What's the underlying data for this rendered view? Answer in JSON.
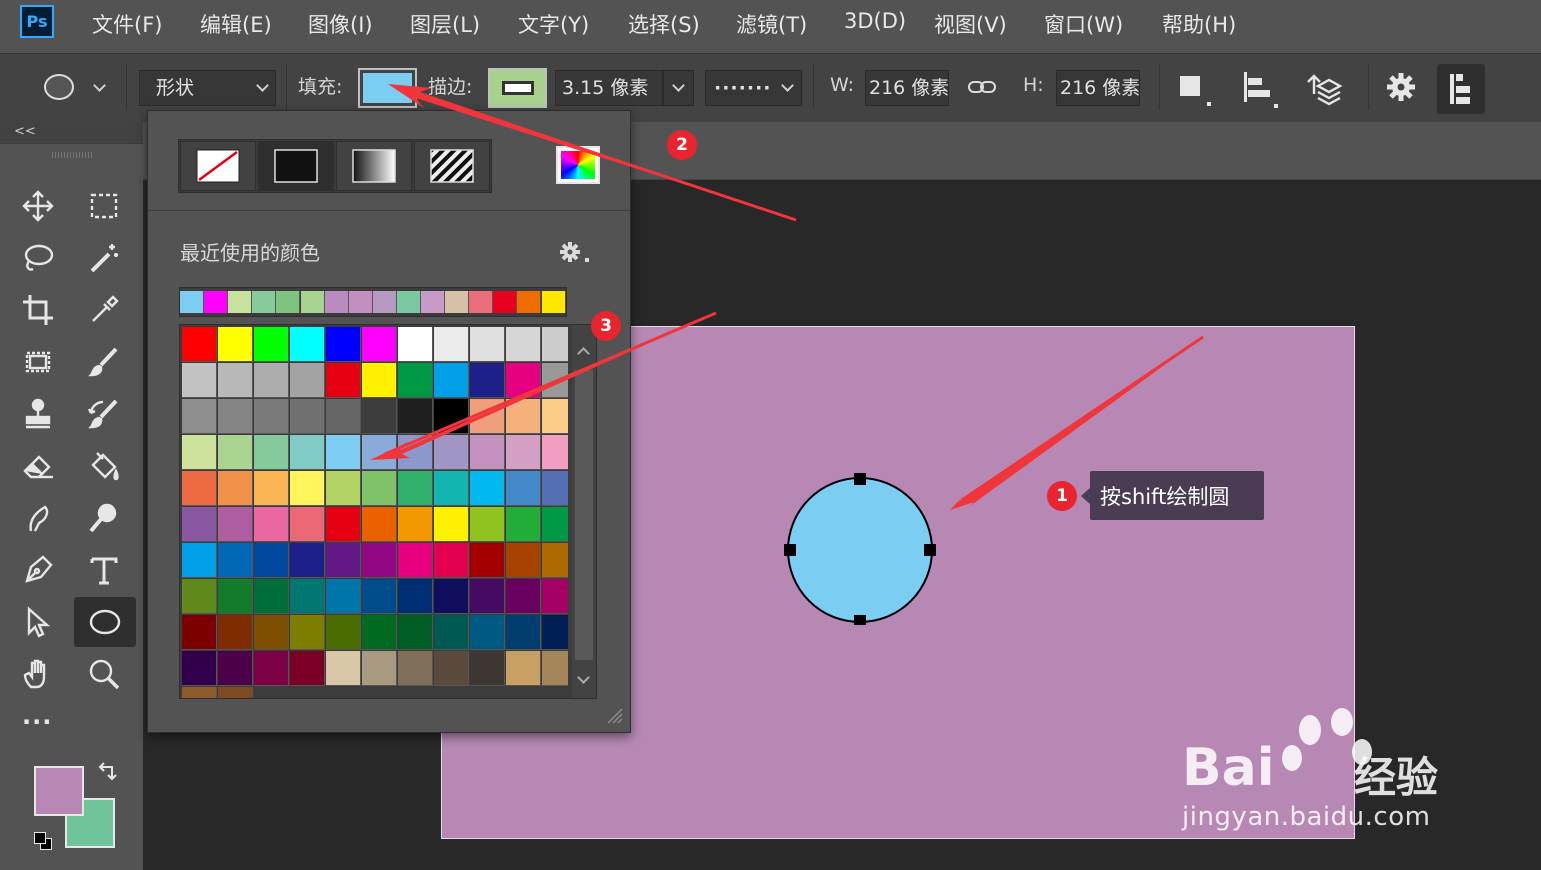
{
  "app": {
    "logo": "Ps"
  },
  "menu": [
    "文件(F)",
    "编辑(E)",
    "图像(I)",
    "图层(L)",
    "文字(Y)",
    "选择(S)",
    "滤镜(T)",
    "3D(D)",
    "视图(V)",
    "窗口(W)",
    "帮助(H)"
  ],
  "options": {
    "mode_value": "形状",
    "fill_label": "填充:",
    "stroke_label": "描边:",
    "stroke_width": "3.15 像素",
    "stroke_style": "·······",
    "width_label": "W:",
    "width_value": "216 像素",
    "height_label": "H:",
    "height_value": "216 像素",
    "fill_color": "#7bcdf2",
    "stroke_color": "#a9d18e"
  },
  "toolbox": {
    "collapse_label": "<<",
    "more_label": "···",
    "foreground_color": "#b688b3",
    "background_color": "#6fc49a"
  },
  "popup": {
    "recent_title": "最近使用的颜色",
    "recent_colors": [
      "#7bcdf2",
      "#ff00ff",
      "#c7e29b",
      "#86cc9a",
      "#7fc47e",
      "#a8d38f",
      "#b98bc0",
      "#c28fc0",
      "#b79ac3",
      "#7bc9a2",
      "#c89ac8",
      "#d6c0a7",
      "#ea6f7a",
      "#e8001f",
      "#ef6c00",
      "#ffe800"
    ],
    "swatch_rows": [
      [
        "#ff0000",
        "#ffff00",
        "#00ff00",
        "#00ffff",
        "#0000ff",
        "#ff00ff",
        "#ffffff",
        "#ebebeb",
        "#e0e0e0",
        "#d6d6d6",
        "#cccccc"
      ],
      [
        "#c2c2c2",
        "#b8b8b8",
        "#adadad",
        "#a3a3a3",
        "#e60012",
        "#fff100",
        "#009944",
        "#00a0e9",
        "#1d2088",
        "#e4007f",
        "#999999"
      ],
      [
        "#8f8f8f",
        "#858585",
        "#7a7a7a",
        "#707070",
        "#666666",
        "#3d3d3d",
        "#1f1f1f",
        "#000000",
        "#f19e7c",
        "#f5b17c",
        "#fbcd89"
      ],
      [
        "#cde39b",
        "#a9d591",
        "#86c99b",
        "#80cbc4",
        "#7ecef4",
        "#88abda",
        "#8c97cb",
        "#a095c5",
        "#c490bf",
        "#d49fc5",
        "#f19ec2"
      ],
      [
        "#ec6941",
        "#f19149",
        "#f8b551",
        "#fff45c",
        "#b3d465",
        "#80c269",
        "#32b16c",
        "#13b5b1",
        "#00b7ee",
        "#448aca",
        "#556fb5"
      ],
      [
        "#8957a1",
        "#ae5da1",
        "#ea68a2",
        "#eb6877",
        "#e60012",
        "#eb6100",
        "#f39800",
        "#fff100",
        "#8fc31f",
        "#22ac38",
        "#009944"
      ],
      [
        "#00a0e9",
        "#0068b7",
        "#00479d",
        "#1d2088",
        "#601986",
        "#920783",
        "#e4007f",
        "#e5004f",
        "#a40000",
        "#a84200",
        "#ac6a00"
      ],
      [
        "#5f8a1b",
        "#127c2b",
        "#006e3a",
        "#007770",
        "#0075a9",
        "#004c8b",
        "#002e73",
        "#0f0f5e",
        "#450a61",
        "#6a005f",
        "#a40066"
      ],
      [
        "#7d0000",
        "#7f2d00",
        "#7e4f00",
        "#7d7d00",
        "#4a6b00",
        "#006b20",
        "#005e25",
        "#005a54",
        "#005982",
        "#003e70",
        "#001f54"
      ],
      [
        "#32004b",
        "#4b0049",
        "#7b0046",
        "#7a0026",
        "#d8c7a7",
        "#a89a81",
        "#807059",
        "#594a3b",
        "#3e3633",
        "#c8a063",
        "#a5865a"
      ]
    ],
    "partial_row": [
      "#8c5a2b",
      "#7d4a22"
    ]
  },
  "annotations": {
    "label_1": "1",
    "label_2": "2",
    "label_3": "3",
    "tooltip_text": "按shift绘制圆",
    "arrow_color": "#f0353b"
  },
  "watermark": {
    "brand": "Bai",
    "brand2": "du",
    "suffix": "经验",
    "url": "jingyan.baidu.com"
  }
}
